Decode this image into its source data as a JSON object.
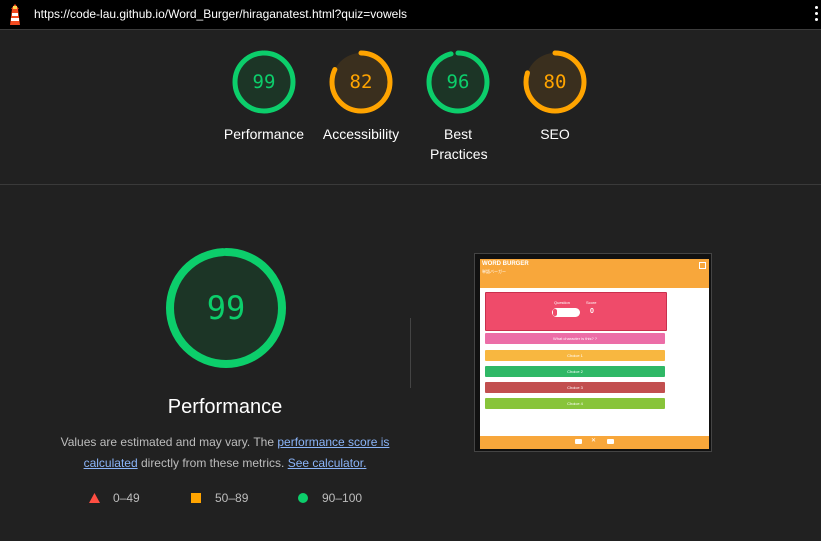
{
  "topbar": {
    "logo_icon": "lighthouse-icon",
    "url": "https://code-lau.github.io/Word_Burger/hiraganatest.html?quiz=vowels",
    "menu_icon": "vertical-dots-icon"
  },
  "summary": [
    {
      "score": "99",
      "label": "Performance",
      "fraction": 0.99,
      "color": "#0cce6b",
      "bg": "#1c3526"
    },
    {
      "score": "82",
      "label": "Accessibility",
      "fraction": 0.82,
      "color": "#ffa400",
      "bg": "#3a2f1e"
    },
    {
      "score": "96",
      "label": "Best Practices",
      "fraction": 0.96,
      "color": "#0cce6b",
      "bg": "#1c3526"
    },
    {
      "score": "80",
      "label": "SEO",
      "fraction": 0.8,
      "color": "#ffa400",
      "bg": "#3a2f1e"
    }
  ],
  "main": {
    "score": "99",
    "fraction": 0.99,
    "color": "#0cce6b",
    "title": "Performance",
    "desc_prefix": "Values are estimated and may vary. The ",
    "link1": "performance score is calculated",
    "desc_middle": " directly from these metrics. ",
    "link2": "See calculator."
  },
  "legend": [
    {
      "icon": "red-triangle-icon",
      "range": "0–49",
      "color": "#ff4e42"
    },
    {
      "icon": "orange-square-icon",
      "range": "50–89",
      "color": "#ffa400"
    },
    {
      "icon": "green-circle-icon",
      "range": "90–100",
      "color": "#0cce6b"
    }
  ],
  "thumbnail": {
    "app_title": "WORD BURGER",
    "app_subtitle": "単語バーガー",
    "question_label": "Question",
    "score_label": "Score",
    "score_value": "0",
    "rows": [
      {
        "text": "What character is this? ?",
        "color": "#ec6da7"
      },
      {
        "text": "Choice 1",
        "color": "#f8b740"
      },
      {
        "text": "Choice 2",
        "color": "#2fb866"
      },
      {
        "text": "Choice 3",
        "color": "#c24f4f"
      },
      {
        "text": "Choice 4",
        "color": "#88c43a"
      }
    ]
  }
}
